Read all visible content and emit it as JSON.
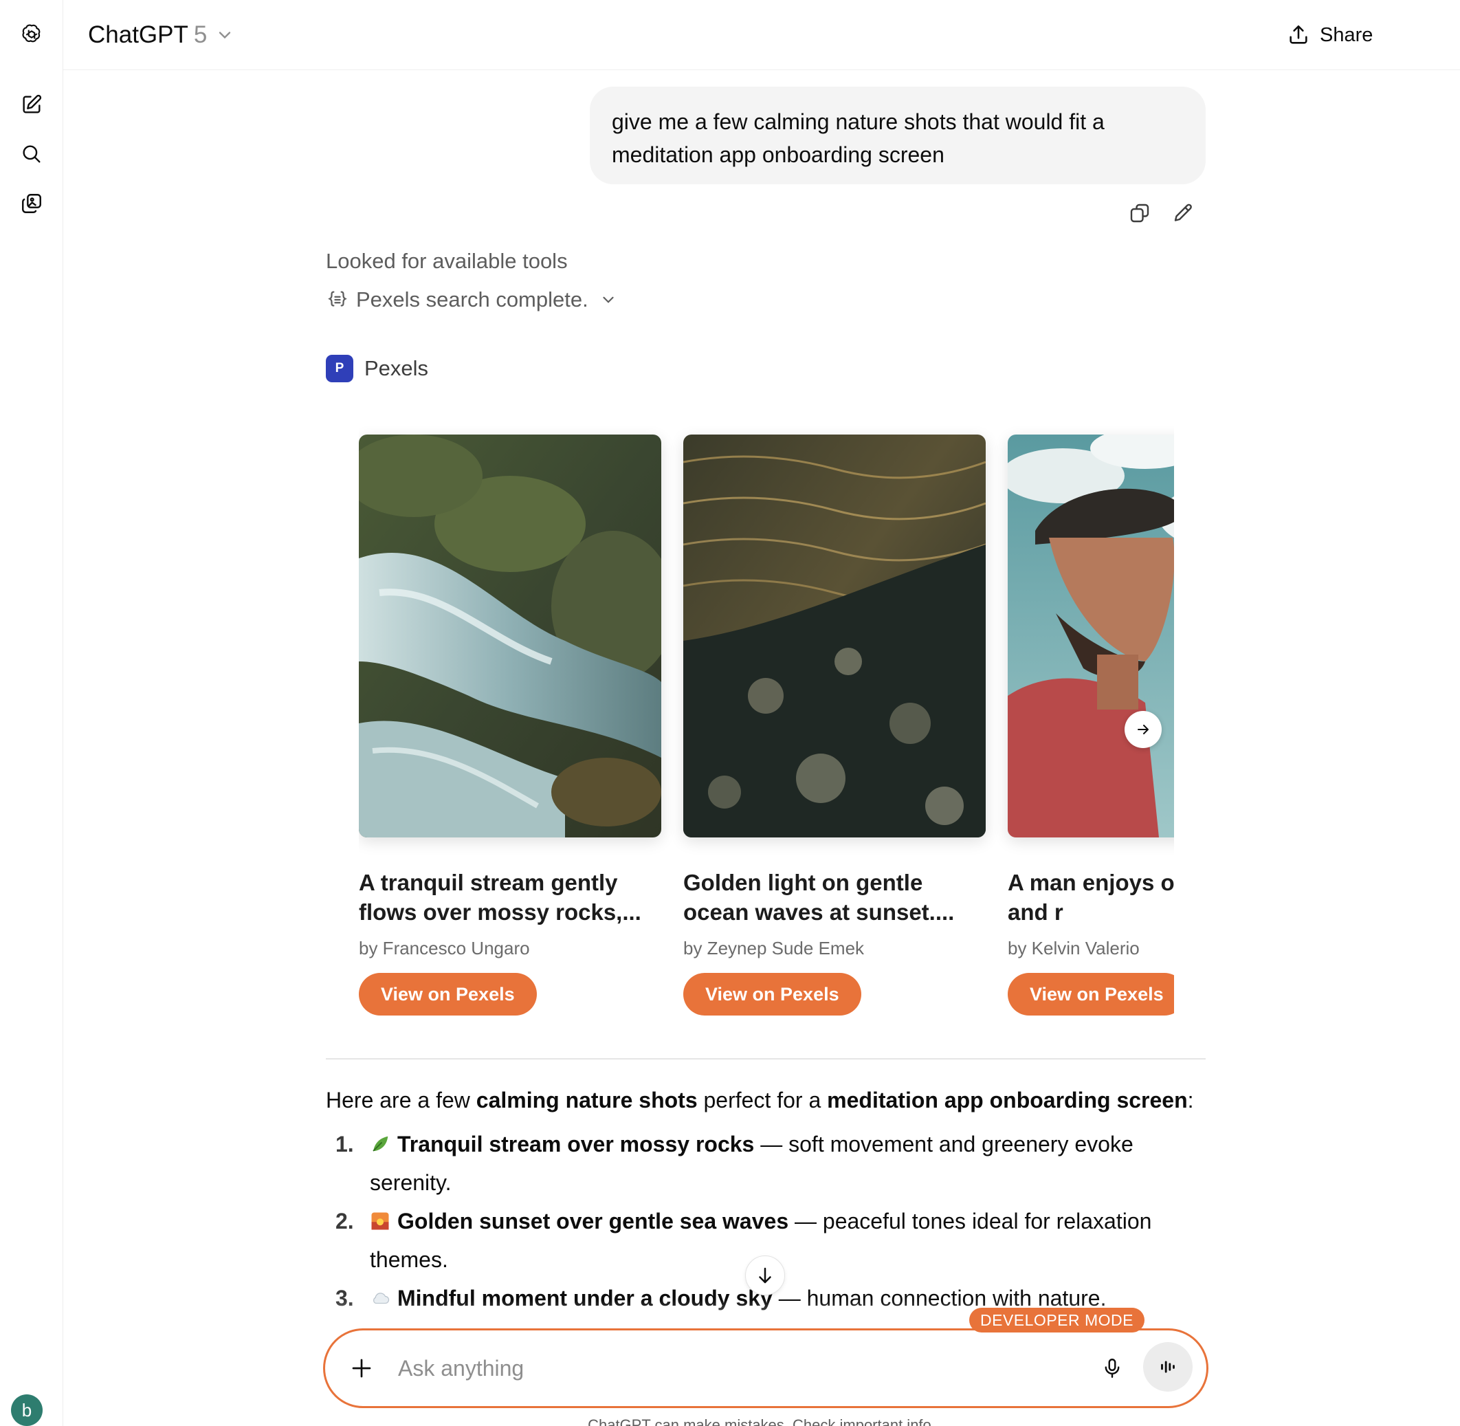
{
  "header": {
    "model_name": "ChatGPT",
    "model_version": "5",
    "share_label": "Share"
  },
  "rail": {
    "avatar_initial": "b"
  },
  "user_message": "give me a few calming nature shots that would fit a meditation app onboarding screen",
  "tool_status": {
    "looked_for": "Looked for available tools",
    "search_complete": "Pexels search complete."
  },
  "source": {
    "logo_letter": "P",
    "name": "Pexels"
  },
  "cards": [
    {
      "title": "A tranquil stream gently flows over mossy rocks,...",
      "author": "by Francesco Ungaro",
      "button": "View on Pexels"
    },
    {
      "title": "Golden light on gentle ocean waves at sunset....",
      "author": "by Zeynep Sude Emek",
      "button": "View on Pexels"
    },
    {
      "title": "A man enjoys o relaxation and r",
      "author": "by Kelvin Valerio",
      "button": "View on Pexels"
    }
  ],
  "answer": {
    "intro_1": "Here are a few ",
    "intro_bold_1": "calming nature shots",
    "intro_2": " perfect for a ",
    "intro_bold_2": "meditation app onboarding screen",
    "intro_3": ":",
    "items": [
      {
        "num": "1.",
        "title": "Tranquil stream over mossy rocks",
        "desc": " — soft movement and greenery evoke serenity."
      },
      {
        "num": "2.",
        "title": "Golden sunset over gentle sea waves",
        "desc": " — peaceful tones ideal for relaxation themes."
      },
      {
        "num": "3.",
        "title": "Mindful moment under a cloudy sky",
        "desc": " — human connection with nature."
      }
    ]
  },
  "composer": {
    "placeholder": "Ask anything",
    "developer_mode": "DEVELOPER MODE"
  },
  "disclaimer": "ChatGPT can make mistakes. Check important info.",
  "colors": {
    "accent": "#e8733a",
    "pexels_logo": "#2f3fb8",
    "bubble": "#f4f4f4"
  }
}
